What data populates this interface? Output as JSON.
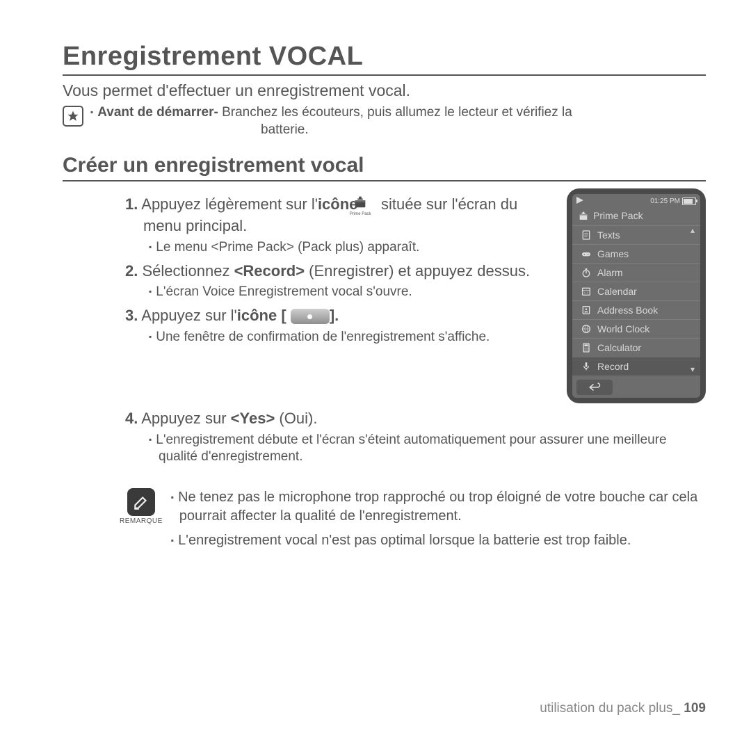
{
  "title": "Enregistrement VOCAL",
  "intro": "Vous permet d'effectuer un enregistrement vocal.",
  "starter": {
    "label": "Avant de démarrer-",
    "text": " Branchez les écouteurs, puis allumez le lecteur et vérifiez la",
    "text2": "batterie."
  },
  "section": "Créer un enregistrement vocal",
  "steps": {
    "s1_a": "Appuyez légèrement sur l'",
    "s1_icon_word": "icône",
    "s1_b": "située sur l'écran du menu principal.",
    "s1_pp_label": "Prime Pack",
    "s1_sub": "Le menu <Prime Pack> (Pack plus) apparaît.",
    "s2": "Sélectionnez <Record> (Enregistrer) et appuyez dessus.",
    "s2_sub": "L'écran Voice Enregistrement vocal s'ouvre.",
    "s3_a": "Appuyez sur l'",
    "s3_icon_word": "icône",
    "s3_b": " [",
    "s3_c": "].",
    "s3_sub": "Une fenêtre de confirmation de l'enregistrement s'affiche.",
    "s4": "Appuyez sur <Yes> (Oui).",
    "s4_sub": "L'enregistrement débute et l'écran s'éteint automatiquement pour assurer une meilleure qualité d'enregistrement."
  },
  "num": {
    "n1": "1.",
    "n2": "2.",
    "n3": "3.",
    "n4": "4."
  },
  "remark": {
    "label": "REMARQUE",
    "r1": "Ne tenez pas le microphone trop rapproché ou trop éloigné de votre bouche car cela pourrait affecter la qualité de l'enregistrement.",
    "r2": "L'enregistrement vocal n'est pas optimal lorsque la batterie est trop faible."
  },
  "device": {
    "time": "01:25 PM",
    "title": "Prime Pack",
    "items": {
      "texts": "Texts",
      "games": "Games",
      "alarm": "Alarm",
      "calendar": "Calendar",
      "address": "Address Book",
      "world": "World Clock",
      "calc": "Calculator",
      "record": "Record"
    }
  },
  "footer": {
    "text": "utilisation du pack plus_",
    "page": "109"
  }
}
